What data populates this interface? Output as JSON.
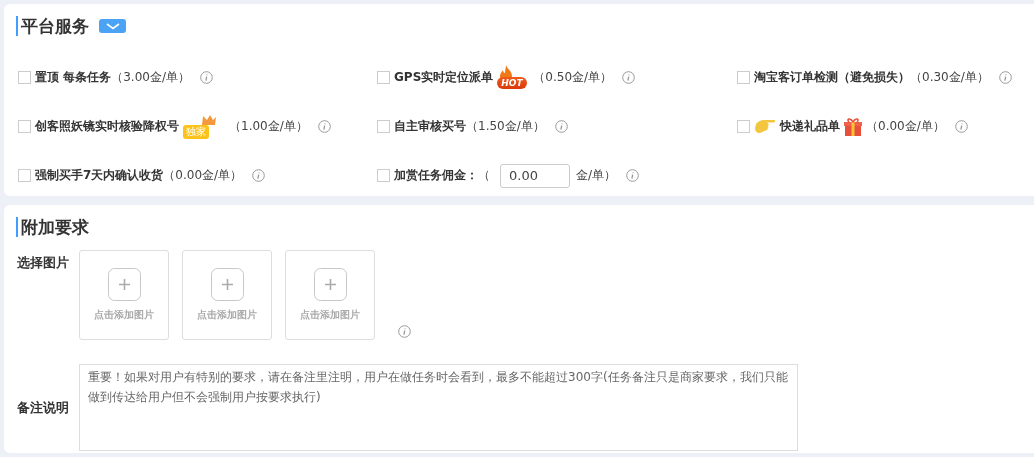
{
  "platform_services": {
    "title": "平台服务",
    "items": [
      {
        "kind": "plain",
        "label": "置顶 每条任务",
        "price": "（3.00金/单）",
        "checked": false
      },
      {
        "kind": "hot",
        "label": "GPS实时定位派单",
        "badge": "HOT",
        "price": "（0.50金/单）",
        "checked": false
      },
      {
        "kind": "plain",
        "label": "淘宝客订单检测（避免损失）",
        "price": "（0.30金/单）",
        "checked": false
      },
      {
        "kind": "exclusive",
        "label": "创客照妖镜实时核验降权号",
        "badge": "独家",
        "price": "（1.00金/单）",
        "checked": false
      },
      {
        "kind": "plain",
        "label": "自主审核买号",
        "price": "（1.50金/单）",
        "checked": false
      },
      {
        "kind": "gift",
        "label": "快递礼品单",
        "price": "（0.00金/单）",
        "checked": false
      },
      {
        "kind": "plain",
        "label": "强制买手7天内确认收货",
        "price": "（0.00金/单）",
        "checked": false
      },
      {
        "kind": "input",
        "label": "加赏任务佣金：",
        "price_open": "（",
        "value": "0.00",
        "price": "金/单）",
        "checked": false
      }
    ]
  },
  "extra_requirements": {
    "title": "附加要求",
    "images": {
      "label": "选择图片",
      "slots": [
        {
          "caption": "点击添加图片"
        },
        {
          "caption": "点击添加图片"
        },
        {
          "caption": "点击添加图片"
        }
      ]
    },
    "remarks": {
      "label": "备注说明",
      "placeholder": "重要！如果对用户有特别的要求，请在备注里注明，用户在做任务时会看到，最多不能超过300字(任务备注只是商家要求，我们只能做到传达给用户但不会强制用户按要求执行)"
    }
  }
}
